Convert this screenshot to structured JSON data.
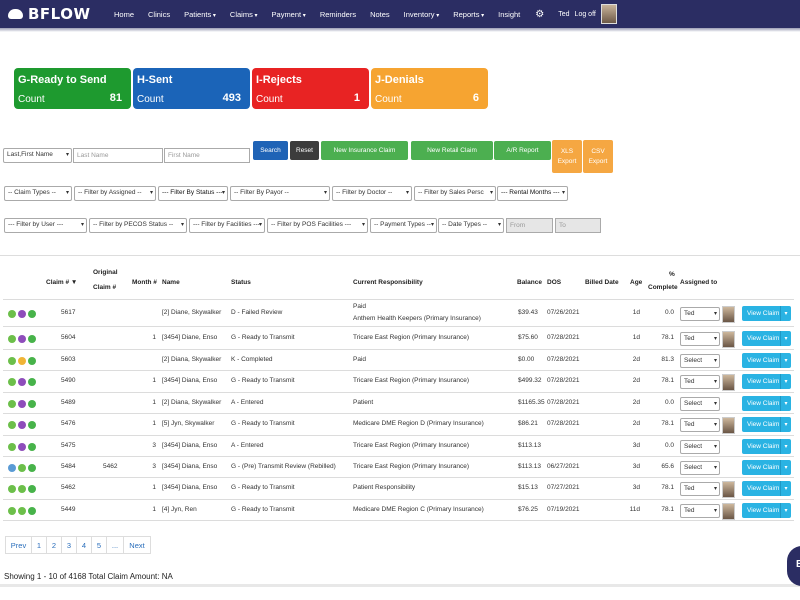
{
  "nav": {
    "logo": "BFLOW",
    "items": [
      {
        "label": "Home",
        "dd": false
      },
      {
        "label": "Clinics",
        "dd": false
      },
      {
        "label": "Patients",
        "dd": true
      },
      {
        "label": "Claims",
        "dd": true
      },
      {
        "label": "Payment",
        "dd": true
      },
      {
        "label": "Reminders",
        "dd": false
      },
      {
        "label": "Notes",
        "dd": false
      },
      {
        "label": "Inventory",
        "dd": true
      },
      {
        "label": "Reports",
        "dd": true
      },
      {
        "label": "Insight",
        "dd": false
      }
    ],
    "user": "Ted",
    "logoff": "Log off"
  },
  "cards": [
    {
      "title": "G-Ready to Send",
      "count_label": "Count",
      "value": "81",
      "color": "#1e9a2f"
    },
    {
      "title": "H-Sent",
      "count_label": "Count",
      "value": "493",
      "color": "#1b64b8"
    },
    {
      "title": "I-Rejects",
      "count_label": "Count",
      "value": "1",
      "color": "#e82323"
    },
    {
      "title": "J-Denials",
      "count_label": "Count",
      "value": "6",
      "color": "#f6a431"
    }
  ],
  "search": {
    "name_order": "Last,First Name",
    "last_name_placeholder": "Last Name",
    "first_name_placeholder": "First Name",
    "search": "Search",
    "reset": "Reset",
    "new_insurance_claim": "New Insurance Claim",
    "new_retail_claim": "New Retail Claim",
    "ar_report": "A/R Report",
    "xls_export_1": "XLS",
    "xls_export_2": "Export",
    "csv_export_1": "CSV",
    "csv_export_2": "Export"
  },
  "filters_row1": [
    "-- Claim Types --",
    "-- Filter by Assigned --",
    "--- Filter By Status ---",
    "-- Filter By Payor --",
    "-- Filter by Doctor --",
    "-- Filter by Sales Persc",
    "--- Rental Months ---"
  ],
  "filters_row2": [
    "--- Filter by User ---",
    "-- Filter by PECOS Status --",
    "--- Filter by Facilities ---",
    "-- Filter by POS Facilities ---",
    "-- Payment Types --",
    "-- Date Types --"
  ],
  "date_from_placeholder": "From",
  "date_to_placeholder": "To",
  "table": {
    "headers": {
      "claim": "Claim # ▼",
      "orig1": "Original",
      "orig2": "Claim #",
      "month": "Month #",
      "name": "Name",
      "status": "Status",
      "resp": "Current Responsibility",
      "balance": "Balance",
      "dos": "DOS",
      "billed": "Billed Date",
      "age": "Age",
      "pct1": "%",
      "pct2": "Complete",
      "assigned": "Assigned to"
    },
    "view_label": "View Claim",
    "rows": [
      {
        "dots": [
          "#6cbf4a",
          "#8e4dbb",
          "#47b34a"
        ],
        "claim": "5617",
        "orig": "",
        "month": "",
        "name": "[2] Diane, Skywalker",
        "status": "D - Failed Review",
        "resp": "Paid",
        "resp2": "Anthem Health Keepers (Primary Insurance)",
        "balance": "$39.43",
        "dos": "07/26/2021",
        "billed": "",
        "age": "1d",
        "pct": "0.0",
        "assigned": "Ted",
        "avatar": true
      },
      {
        "dots": [
          "#6cbf4a",
          "#8e4dbb",
          "#47b34a"
        ],
        "claim": "5604",
        "orig": "",
        "month": "1",
        "name": "[3454] Diane, Enso",
        "status": "G - Ready to Transmit",
        "resp": "Tricare East Region (Primary Insurance)",
        "resp2": "",
        "balance": "$75.60",
        "dos": "07/28/2021",
        "billed": "",
        "age": "1d",
        "pct": "78.1",
        "assigned": "Ted",
        "avatar": true
      },
      {
        "dots": [
          "#6cbf4a",
          "#f0b436",
          "#47b34a"
        ],
        "claim": "5603",
        "orig": "",
        "month": "",
        "name": "[2] Diana, Skywalker",
        "status": "K - Completed",
        "resp": "Paid",
        "resp2": "",
        "balance": "$0.00",
        "dos": "07/28/2021",
        "billed": "",
        "age": "2d",
        "pct": "81.3",
        "assigned": "Select",
        "avatar": false
      },
      {
        "dots": [
          "#6cbf4a",
          "#8e4dbb",
          "#47b34a"
        ],
        "claim": "5490",
        "orig": "",
        "month": "1",
        "name": "[3454] Diana, Enso",
        "status": "G - Ready to Transmit",
        "resp": "Tricare East Region (Primary Insurance)",
        "resp2": "",
        "balance": "$499.32",
        "dos": "07/28/2021",
        "billed": "",
        "age": "2d",
        "pct": "78.1",
        "assigned": "Ted",
        "avatar": true
      },
      {
        "dots": [
          "#6cbf4a",
          "#8e4dbb",
          "#47b34a"
        ],
        "claim": "5489",
        "orig": "",
        "month": "1",
        "name": "[2] Diana, Skywalker",
        "status": "A - Entered",
        "resp": "Patient",
        "resp2": "",
        "balance": "$1165.35",
        "dos": "07/28/2021",
        "billed": "",
        "age": "2d",
        "pct": "0.0",
        "assigned": "Select",
        "avatar": false
      },
      {
        "dots": [
          "#6cbf4a",
          "#8e4dbb",
          "#47b34a"
        ],
        "claim": "5476",
        "orig": "",
        "month": "1",
        "name": "[5] Jyn, Skywalker",
        "status": "G - Ready to Transmit",
        "resp": "Medicare DME Region D (Primary Insurance)",
        "resp2": "",
        "balance": "$86.21",
        "dos": "07/28/2021",
        "billed": "",
        "age": "2d",
        "pct": "78.1",
        "assigned": "Ted",
        "avatar": true
      },
      {
        "dots": [
          "#6cbf4a",
          "#8e4dbb",
          "#47b34a"
        ],
        "claim": "5475",
        "orig": "",
        "month": "3",
        "name": "[3454] Diana, Enso",
        "status": "A - Entered",
        "resp": "Tricare East Region (Primary Insurance)",
        "resp2": "",
        "balance": "$113.13",
        "dos": "",
        "billed": "",
        "age": "3d",
        "pct": "0.0",
        "assigned": "Select",
        "avatar": false
      },
      {
        "dots": [
          "#5a9bd5",
          "#6cbf4a",
          "#47b34a"
        ],
        "claim": "5484",
        "orig": "5462",
        "month": "3",
        "name": "[3454] Diana, Enso",
        "status": "G - (Pre) Transmit Review (Rebilled)",
        "resp": "Tricare East Region (Primary Insurance)",
        "resp2": "",
        "balance": "$113.13",
        "dos": "06/27/2021",
        "billed": "",
        "age": "3d",
        "pct": "65.6",
        "assigned": "Select",
        "avatar": false
      },
      {
        "dots": [
          "#6cbf4a",
          "#6cbf4a",
          "#47b34a"
        ],
        "claim": "5462",
        "orig": "",
        "month": "1",
        "name": "[3454] Diana, Enso",
        "status": "G - Ready to Transmit",
        "resp": "Patient Responsibility",
        "resp2": "",
        "balance": "$15.13",
        "dos": "07/27/2021",
        "billed": "",
        "age": "3d",
        "pct": "78.1",
        "assigned": "Ted",
        "avatar": true
      },
      {
        "dots": [
          "#6cbf4a",
          "#6cbf4a",
          "#47b34a"
        ],
        "claim": "5449",
        "orig": "",
        "month": "1",
        "name": "[4] Jyn, Ren",
        "status": "G - Ready to Transmit",
        "resp": "Medicare DME Region C (Primary Insurance)",
        "resp2": "",
        "balance": "$76.25",
        "dos": "07/19/2021",
        "billed": "",
        "age": "11d",
        "pct": "78.1",
        "assigned": "Ted",
        "avatar": true
      }
    ]
  },
  "pagination": [
    "Prev",
    "1",
    "2",
    "3",
    "4",
    "5",
    "...",
    "Next"
  ],
  "showing": "Showing 1 - 10 of 4168 Total Claim Amount: NA"
}
